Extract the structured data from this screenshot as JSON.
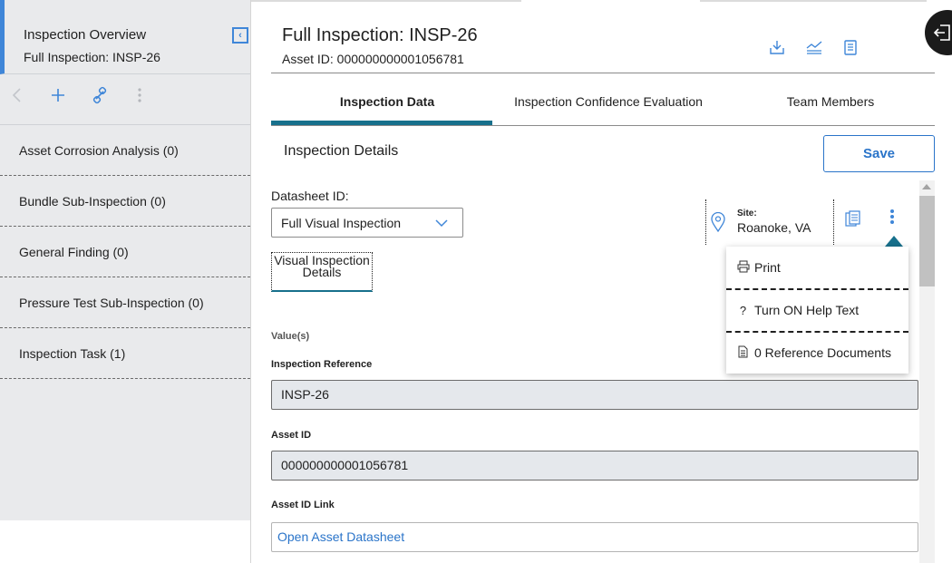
{
  "left_panel": {
    "title": "Inspection Overview",
    "subtitle": "Full Inspection: INSP-26",
    "collapse_icon": "collapse-left-icon",
    "toolbar": [
      "back-icon",
      "add-icon",
      "link-icon",
      "more-icon"
    ],
    "items": [
      {
        "label": "Asset Corrosion Analysis (0)"
      },
      {
        "label": "Bundle Sub-Inspection (0)"
      },
      {
        "label": "General Finding (0)"
      },
      {
        "label": "Pressure Test Sub-Inspection (0)"
      },
      {
        "label": "Inspection Task (1)"
      }
    ]
  },
  "header": {
    "title": "Full Inspection: INSP-26",
    "asset_line": "Asset ID: 000000000001056781",
    "actions": [
      "download-icon",
      "chart-trend-icon",
      "clipboard-icon"
    ]
  },
  "tabs": [
    {
      "label": "Inspection Data",
      "active": true
    },
    {
      "label": "Inspection Confidence Evaluation",
      "active": false
    },
    {
      "label": "Team Members",
      "active": false
    }
  ],
  "section": {
    "title": "Inspection Details",
    "save_label": "Save"
  },
  "datasheet": {
    "label": "Datasheet ID:",
    "value": "Full Visual Inspection"
  },
  "site": {
    "label": "Site:",
    "value": "Roanoke, VA"
  },
  "subtab": {
    "label": "Visual Inspection Details"
  },
  "fields": {
    "values_caption": "Value(s)",
    "inspection_reference": {
      "label": "Inspection Reference",
      "value": "INSP-26"
    },
    "asset_id": {
      "label": "Asset ID",
      "value": "000000000001056781"
    },
    "asset_id_link": {
      "label": "Asset ID Link",
      "value": "Open Asset Datasheet"
    }
  },
  "menu": {
    "items": [
      {
        "icon": "print-icon",
        "label": "Print"
      },
      {
        "icon": "help-icon",
        "label": "Turn ON Help Text"
      },
      {
        "icon": "document-icon",
        "label": "0 Reference Documents"
      }
    ]
  },
  "colors": {
    "accent_blue": "#3f86d8",
    "link_blue": "#2a74c9",
    "tab_teal": "#17708c",
    "panel_gray": "#e9eaec",
    "field_gray": "#e5e8ec"
  }
}
